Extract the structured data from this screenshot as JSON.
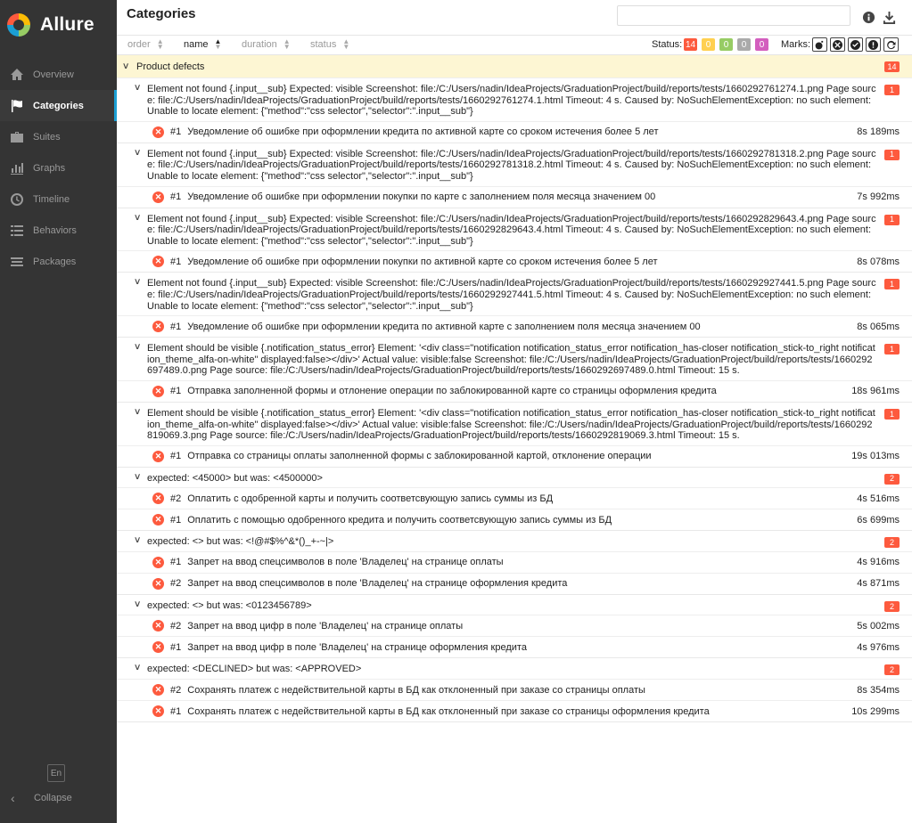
{
  "app": {
    "name": "Allure"
  },
  "sidebar": {
    "items": [
      {
        "label": "Overview",
        "icon": "home-icon"
      },
      {
        "label": "Categories",
        "icon": "flag-icon",
        "active": true
      },
      {
        "label": "Suites",
        "icon": "briefcase-icon"
      },
      {
        "label": "Graphs",
        "icon": "bar-chart-icon"
      },
      {
        "label": "Timeline",
        "icon": "clock-icon"
      },
      {
        "label": "Behaviors",
        "icon": "list-icon"
      },
      {
        "label": "Packages",
        "icon": "stack-icon"
      }
    ],
    "language": "En",
    "collapse_label": "Collapse"
  },
  "header": {
    "title": "Categories",
    "search_value": "",
    "info_icon": "info-icon",
    "download_icon": "download-icon"
  },
  "toolbar": {
    "sort": {
      "order": "order",
      "name": "name",
      "duration": "duration",
      "status": "status"
    },
    "status_label": "Status:",
    "status_counts": [
      {
        "status": "failed",
        "count": "14",
        "color": "#fd5a3e"
      },
      {
        "status": "broken",
        "count": "0",
        "color": "#ffd050"
      },
      {
        "status": "passed",
        "count": "0",
        "color": "#97cc64"
      },
      {
        "status": "skipped",
        "count": "0",
        "color": "#aaaaaa"
      },
      {
        "status": "unknown",
        "count": "0",
        "color": "#d35ebe"
      }
    ],
    "marks_label": "Marks:"
  },
  "tree": {
    "group": {
      "name": "Product defects",
      "count": "14"
    },
    "categories": [
      {
        "title": "Element not found {.input__sub} Expected: visible Screenshot: file:/C:/Users/nadin/IdeaProjects/GraduationProject/build/reports/tests/1660292761274.1.png Page source: file:/C:/Users/nadin/IdeaProjects/GraduationProject/build/reports/tests/1660292761274.1.html Timeout: 4 s. Caused by: NoSuchElementException: no such element: Unable to locate element: {\"method\":\"css selector\",\"selector\":\".input__sub\"}",
        "count": "1",
        "tests": [
          {
            "num": "#1",
            "name": "Уведомление об ошибке при оформлении кредита по активной карте со сроком истечения более 5 лет",
            "duration": "8s 189ms"
          }
        ]
      },
      {
        "title": "Element not found {.input__sub} Expected: visible Screenshot: file:/C:/Users/nadin/IdeaProjects/GraduationProject/build/reports/tests/1660292781318.2.png Page source: file:/C:/Users/nadin/IdeaProjects/GraduationProject/build/reports/tests/1660292781318.2.html Timeout: 4 s. Caused by: NoSuchElementException: no such element: Unable to locate element: {\"method\":\"css selector\",\"selector\":\".input__sub\"}",
        "count": "1",
        "tests": [
          {
            "num": "#1",
            "name": "Уведомление об ошибке при оформлении покупки по карте с заполнением поля месяца значением 00",
            "duration": "7s 992ms"
          }
        ]
      },
      {
        "title": "Element not found {.input__sub} Expected: visible Screenshot: file:/C:/Users/nadin/IdeaProjects/GraduationProject/build/reports/tests/1660292829643.4.png Page source: file:/C:/Users/nadin/IdeaProjects/GraduationProject/build/reports/tests/1660292829643.4.html Timeout: 4 s. Caused by: NoSuchElementException: no such element: Unable to locate element: {\"method\":\"css selector\",\"selector\":\".input__sub\"}",
        "count": "1",
        "tests": [
          {
            "num": "#1",
            "name": "Уведомление об ошибке при оформлении покупки по активной карте со сроком истечения более 5 лет",
            "duration": "8s 078ms"
          }
        ]
      },
      {
        "title": "Element not found {.input__sub} Expected: visible Screenshot: file:/C:/Users/nadin/IdeaProjects/GraduationProject/build/reports/tests/1660292927441.5.png Page source: file:/C:/Users/nadin/IdeaProjects/GraduationProject/build/reports/tests/1660292927441.5.html Timeout: 4 s. Caused by: NoSuchElementException: no such element: Unable to locate element: {\"method\":\"css selector\",\"selector\":\".input__sub\"}",
        "count": "1",
        "tests": [
          {
            "num": "#1",
            "name": "Уведомление об ошибке при оформлении кредита по активной карте с заполнением поля месяца значением 00",
            "duration": "8s 065ms"
          }
        ]
      },
      {
        "title": "Element should be visible {.notification_status_error} Element: '<div class=\"notification notification_status_error notification_has-closer notification_stick-to_right notification_theme_alfa-on-white\" displayed:false></div>' Actual value: visible:false Screenshot: file:/C:/Users/nadin/IdeaProjects/GraduationProject/build/reports/tests/1660292697489.0.png Page source: file:/C:/Users/nadin/IdeaProjects/GraduationProject/build/reports/tests/1660292697489.0.html Timeout: 15 s.",
        "count": "1",
        "tests": [
          {
            "num": "#1",
            "name": "Отправка заполненной формы и отлонение операции по заблокированной карте со страницы оформления кредита",
            "duration": "18s 961ms"
          }
        ]
      },
      {
        "title": "Element should be visible {.notification_status_error} Element: '<div class=\"notification notification_status_error notification_has-closer notification_stick-to_right notification_theme_alfa-on-white\" displayed:false></div>' Actual value: visible:false Screenshot: file:/C:/Users/nadin/IdeaProjects/GraduationProject/build/reports/tests/1660292819069.3.png Page source: file:/C:/Users/nadin/IdeaProjects/GraduationProject/build/reports/tests/1660292819069.3.html Timeout: 15 s.",
        "count": "1",
        "tests": [
          {
            "num": "#1",
            "name": "Отправка со страницы оплаты заполненной формы с заблокированной картой, отклонение операции",
            "duration": "19s 013ms"
          }
        ]
      },
      {
        "title": "expected: <45000> but was: <4500000>",
        "count": "2",
        "tests": [
          {
            "num": "#2",
            "name": "Оплатить с одобренной карты и получить соответсвующую запись суммы из БД",
            "duration": "4s 516ms"
          },
          {
            "num": "#1",
            "name": "Оплатить с помощью одобренного кредита и получить соответсвующую запись суммы из БД",
            "duration": "6s 699ms"
          }
        ]
      },
      {
        "title": "expected: <> but was: <!@#$%^&*()_+-~|>",
        "count": "2",
        "tests": [
          {
            "num": "#1",
            "name": "Запрет на ввод спецсимволов в поле 'Владелец' на странице оплаты",
            "duration": "4s 916ms"
          },
          {
            "num": "#2",
            "name": "Запрет на ввод спецсимволов в поле 'Владелец' на странице оформления кредита",
            "duration": "4s 871ms"
          }
        ]
      },
      {
        "title": "expected: <> but was: <0123456789>",
        "count": "2",
        "tests": [
          {
            "num": "#2",
            "name": "Запрет на ввод цифр в поле 'Владелец' на странице оплаты",
            "duration": "5s 002ms"
          },
          {
            "num": "#1",
            "name": "Запрет на ввод цифр в поле 'Владелец' на странице оформления кредита",
            "duration": "4s 976ms"
          }
        ]
      },
      {
        "title": "expected: <DECLINED> but was: <APPROVED>",
        "count": "2",
        "tests": [
          {
            "num": "#2",
            "name": "Сохранять платеж с недействительной карты в БД как отклоненный при заказе со страницы оплаты",
            "duration": "8s 354ms"
          },
          {
            "num": "#1",
            "name": "Сохранять платеж с недействительной карты в БД как отклоненный при заказе со страницы оформления кредита",
            "duration": "10s 299ms"
          }
        ]
      }
    ]
  }
}
